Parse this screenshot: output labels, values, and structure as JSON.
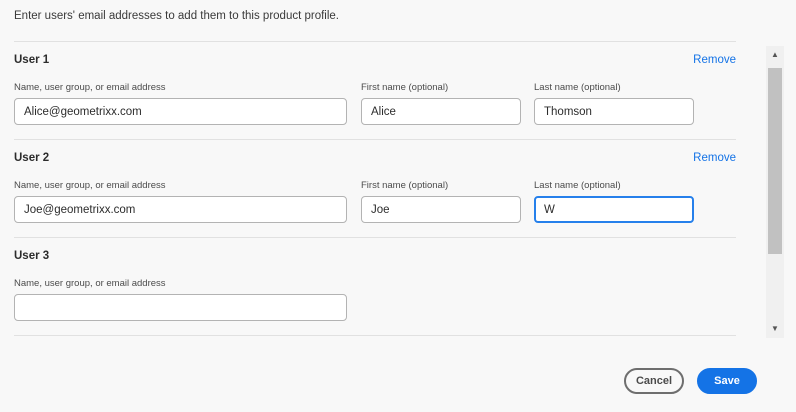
{
  "intro_text": "Enter users' email addresses to add them to this product profile.",
  "labels": {
    "email": "Name, user group, or email address",
    "first_name": "First name (optional)",
    "last_name": "Last name (optional)",
    "remove": "Remove"
  },
  "users": [
    {
      "title": "User 1",
      "email": "Alice@geometrixx.com",
      "first_name": "Alice",
      "last_name": "Thomson"
    },
    {
      "title": "User 2",
      "email": "Joe@geometrixx.com",
      "first_name": "Joe",
      "last_name": "W"
    },
    {
      "title": "User 3",
      "email": ""
    }
  ],
  "buttons": {
    "cancel": "Cancel",
    "save": "Save"
  },
  "icons": {
    "scroll_up": "triangle-up-icon",
    "scroll_down": "triangle-down-icon"
  },
  "colors": {
    "accent": "#1473e6",
    "focus": "#2680eb"
  }
}
